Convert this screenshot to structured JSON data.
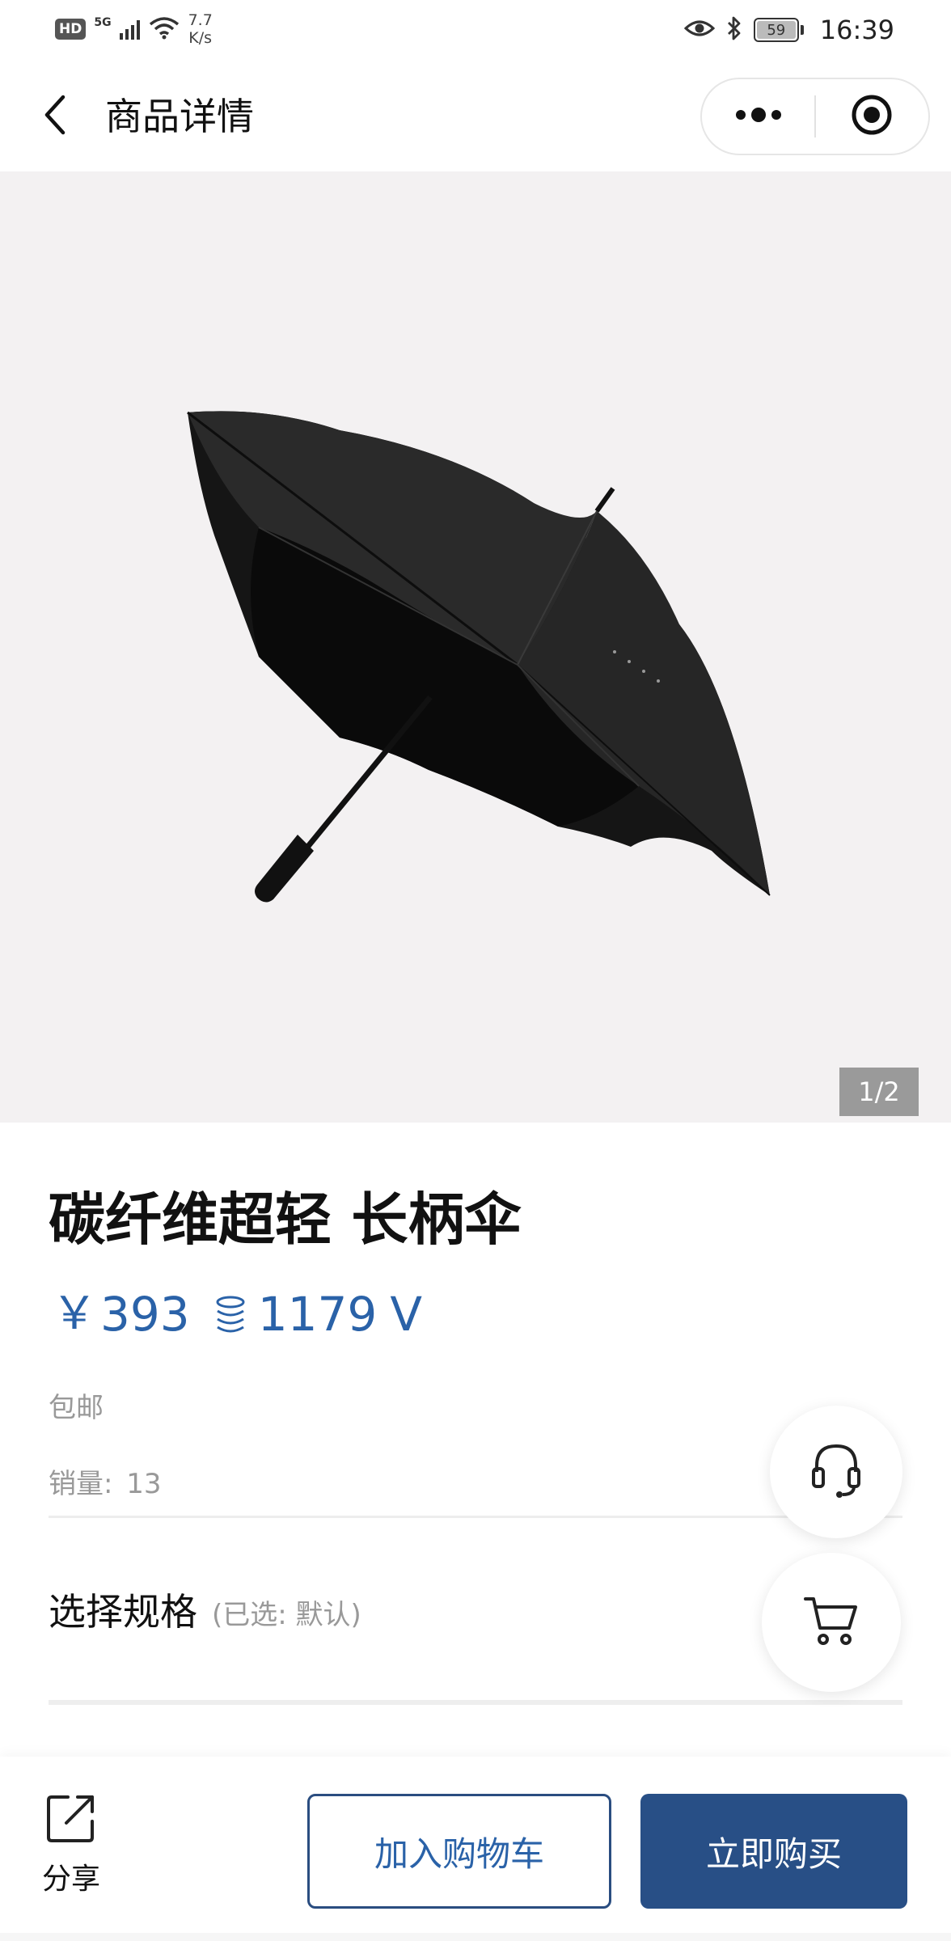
{
  "status_bar": {
    "hd": "HD",
    "network": "5G",
    "speed_top": "7.7",
    "speed_bottom": "K/s",
    "battery": "59",
    "time": "16:39"
  },
  "nav": {
    "title": "商品详情",
    "icons": [
      "back-icon",
      "more-icon",
      "close-miniprogram-icon"
    ]
  },
  "product": {
    "image_counter": "1/2",
    "title": "碳纤维超轻 长柄伞",
    "price_currency": "￥",
    "price": "393",
    "points": "1179",
    "points_unit": "V",
    "shipping": "包邮",
    "sales_label": "销量:",
    "sales_value": "13",
    "sales_text": "销量:  13"
  },
  "spec": {
    "label": "选择规格",
    "selected": "(已选: 默认)"
  },
  "floating": {
    "icons": [
      "headset-icon",
      "cart-icon"
    ]
  },
  "bottom_bar": {
    "share_label": "分享",
    "add_to_cart": "加入购物车",
    "buy_now": "立即购买"
  },
  "colors": {
    "accent": "#2a62a8",
    "buy_button": "#284f86",
    "image_bg": "#f3f1f2"
  }
}
